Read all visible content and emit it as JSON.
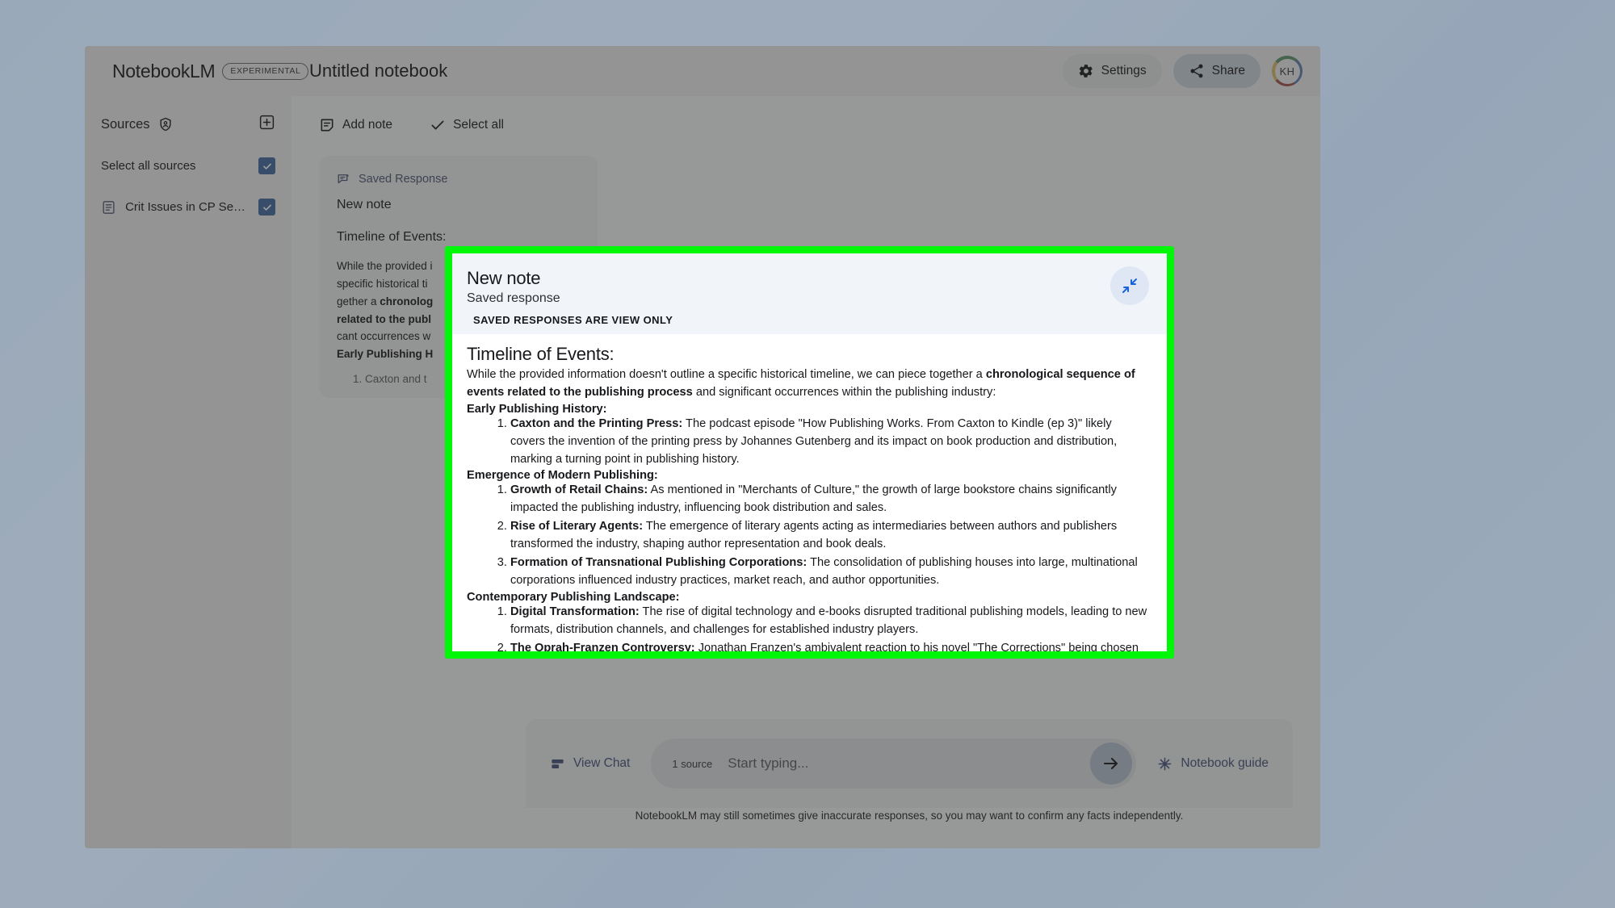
{
  "topbar": {
    "brand": "NotebookLM",
    "experimental_badge": "EXPERIMENTAL",
    "notebook_title": "Untitled notebook",
    "settings_label": "Settings",
    "share_label": "Share",
    "avatar_initials": "KH"
  },
  "sidebar": {
    "sources_title": "Sources",
    "select_all_label": "Select all sources",
    "sources": [
      {
        "label": "Crit Issues in CP Semi..."
      }
    ]
  },
  "toolbar": {
    "add_note_label": "Add note",
    "select_all_label": "Select all"
  },
  "note_card": {
    "saved_tag": "Saved Response",
    "title": "New note",
    "heading": "Timeline of Events:",
    "body_prefix": "While the provided i",
    "body_line2": "specific historical ti",
    "body_line3": "gether a ",
    "body_line3_bold": "chronolog",
    "body_line4_bold": "related to the publ",
    "body_line5": "cant occurrences w",
    "body_line6_bold": "Early Publishing H",
    "list_item1": "1. Caxton and t"
  },
  "modal": {
    "title": "New note",
    "subtitle": "Saved response",
    "view_only_notice": "SAVED RESPONSES ARE VIEW ONLY",
    "collapse_icon": "collapse-arrows-icon",
    "highlight_color": "#00f708",
    "doc": {
      "heading": "Timeline of Events:",
      "intro_part1": "While the provided information doesn't outline a specific historical timeline, we can piece together a ",
      "intro_bold": "chronological sequence of events related to the publishing process",
      "intro_part2": " and significant occurrences within the publishing industry:",
      "sections": [
        {
          "heading": "Early Publishing History:",
          "items": [
            {
              "term": "Caxton and the Printing Press:",
              "text": " The podcast episode \"How Publishing Works. From Caxton to Kindle (ep 3)\" likely covers the invention of the printing press by Johannes Gutenberg and its impact on book production and distribution, marking a turning point in publishing history."
            }
          ]
        },
        {
          "heading": "Emergence of Modern Publishing:",
          "items": [
            {
              "term": "Growth of Retail Chains:",
              "text": " As mentioned in \"Merchants of Culture,\" the growth of large bookstore chains significantly impacted the publishing industry, influencing book distribution and sales."
            },
            {
              "term": "Rise of Literary Agents:",
              "text": " The emergence of literary agents acting as intermediaries between authors and publishers transformed the industry, shaping author representation and book deals."
            },
            {
              "term": "Formation of Transnational Publishing Corporations:",
              "text": " The consolidation of publishing houses into large, multinational corporations influenced industry practices, market reach, and author opportunities."
            }
          ]
        },
        {
          "heading": "Contemporary Publishing Landscape:",
          "items": [
            {
              "term": "Digital Transformation:",
              "text": " The rise of digital technology and e-books disrupted traditional publishing models, leading to new formats, distribution channels, and challenges for established industry players."
            },
            {
              "term": "The Oprah-Franzen Controversy:",
              "text": " Jonathan Franzen's ambivalent reaction to his novel \"The Corrections\" being chosen for Oprah's Book Club sparked a major controversy, highlighting tensions between literary fiction, popular culture, and"
            }
          ]
        }
      ]
    }
  },
  "chatbar": {
    "view_chat_label": "View Chat",
    "source_count_label": "1 source",
    "input_value": "",
    "input_placeholder": "Start typing...",
    "notebook_guide_label": "Notebook guide",
    "disclaimer": "NotebookLM may still sometimes give inaccurate responses, so you may want to confirm any facts independently."
  }
}
